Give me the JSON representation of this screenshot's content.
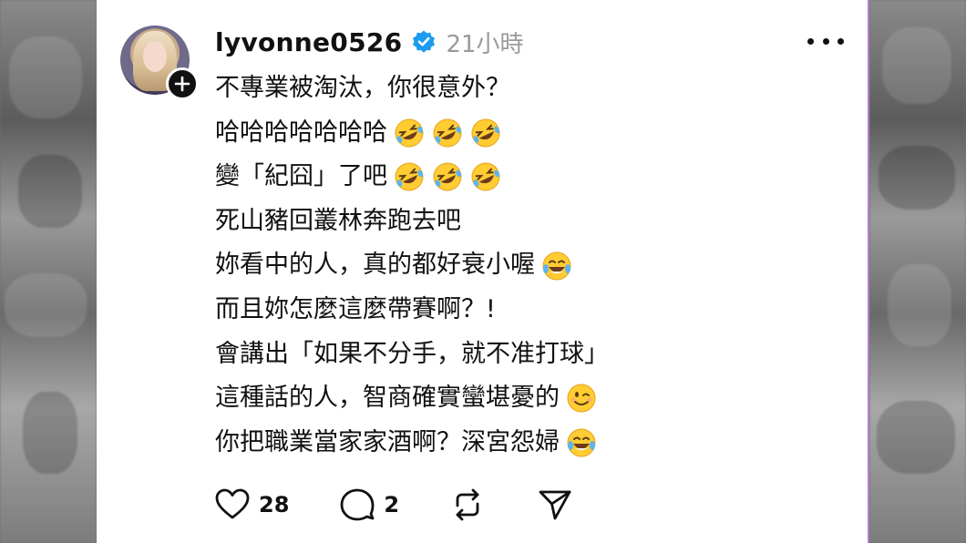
{
  "post": {
    "username": "lyvonne0526",
    "time": "21小時",
    "lines": [
      {
        "text": "不專業被淘汰，你很意外？",
        "emoji": []
      },
      {
        "text": "哈哈哈哈哈哈哈",
        "emoji": [
          "rofl-emoji",
          "rofl-emoji",
          "rofl-emoji"
        ]
      },
      {
        "text": "變「紀囧」了吧",
        "emoji": [
          "rofl-emoji",
          "rofl-emoji",
          "rofl-emoji"
        ]
      },
      {
        "text": "死山豬回叢林奔跑去吧",
        "emoji": []
      },
      {
        "text": "妳看中的人，真的都好衰小喔",
        "emoji": [
          "tears-of-joy-emoji"
        ]
      },
      {
        "text": "而且妳怎麼這麼帶賽啊？!",
        "emoji": []
      },
      {
        "text": "會講出「如果不分手，就不准打球」",
        "emoji": []
      },
      {
        "text": "這種話的人，智商確實蠻堪憂的",
        "emoji": [
          "winking-face-emoji"
        ]
      },
      {
        "text": "你把職業當家家酒啊？深宮怨婦",
        "emoji": [
          "tears-of-joy-emoji"
        ]
      }
    ]
  },
  "actions": {
    "like_count": "28",
    "comment_count": "2"
  },
  "icons": {
    "verified": "verified-badge-icon",
    "more": "more-options-icon",
    "follow": "plus-icon",
    "like": "heart-icon",
    "comment": "comment-bubble-icon",
    "repost": "repost-icon",
    "share": "share-send-icon"
  },
  "colors": {
    "verified_blue": "#1d9bf0",
    "time_gray": "#9a9a9a",
    "text": "#111111",
    "background": "#ffffff"
  }
}
